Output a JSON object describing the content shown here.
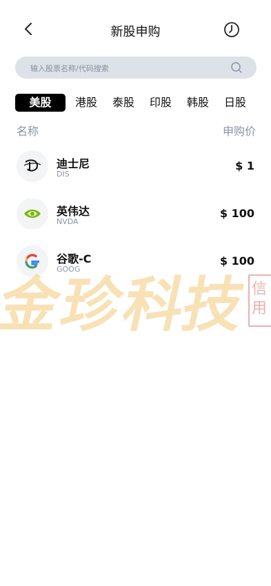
{
  "header": {
    "title": "新股申购"
  },
  "search": {
    "placeholder": "输入股票名称/代码搜索"
  },
  "tabs": [
    {
      "label": "美股",
      "active": true
    },
    {
      "label": "港股",
      "active": false
    },
    {
      "label": "泰股",
      "active": false
    },
    {
      "label": "印股",
      "active": false
    },
    {
      "label": "韩股",
      "active": false
    },
    {
      "label": "日股",
      "active": false
    }
  ],
  "columns": {
    "name": "名称",
    "price": "申购价"
  },
  "stocks": [
    {
      "name": "迪士尼",
      "code": "DIS",
      "price": "$ 1",
      "logo": "disney-logo"
    },
    {
      "name": "英伟达",
      "code": "NVDA",
      "price": "$ 100",
      "logo": "nvidia-logo"
    },
    {
      "name": "谷歌-C",
      "code": "GOOG",
      "price": "$ 100",
      "logo": "google-logo"
    }
  ],
  "watermark": {
    "text": "金珍科技",
    "seal": "信用"
  }
}
